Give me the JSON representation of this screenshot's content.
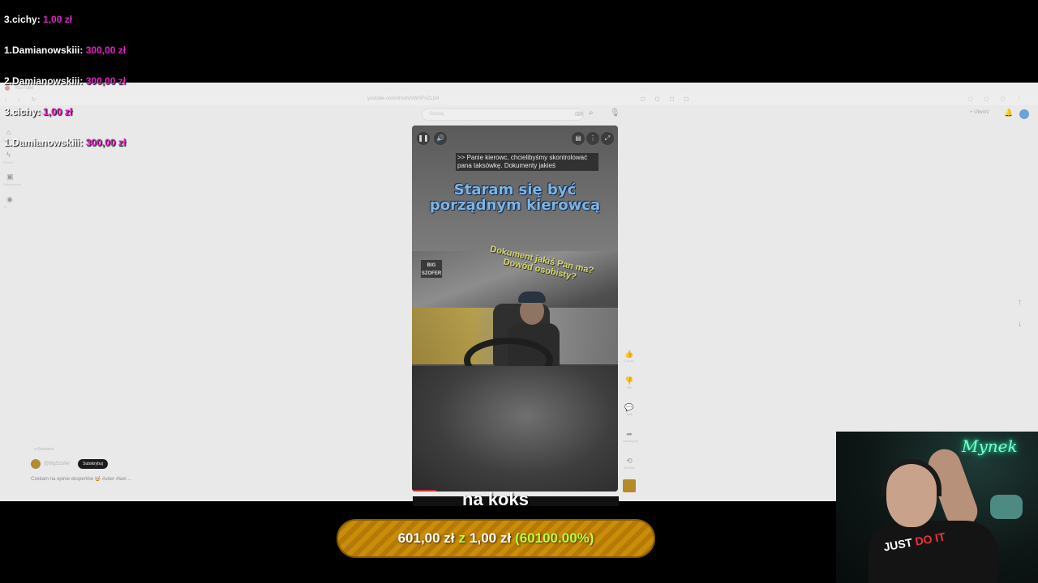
{
  "donations": [
    {
      "name": "3.cichy:",
      "amount": "1,00 zł"
    },
    {
      "name": "1.Damianowskiii:",
      "amount": "300,00 zł"
    },
    {
      "name": "2.Damianowskiii:",
      "amount": "300,00 zł"
    },
    {
      "name": "3.cichy:",
      "amount": "1,00 zł"
    },
    {
      "name": "1.Damianowskiii:",
      "amount": "300,00 zł"
    }
  ],
  "browser": {
    "url": "youtube.com/shorts/xWSFnZLD4",
    "logo": "YouTube",
    "search_placeholder": "Szukaj",
    "create_label": "+ Utwórz"
  },
  "sidebar": [
    {
      "icon": "home-icon",
      "glyph": "⌂",
      "label": "Główna"
    },
    {
      "icon": "shorts-icon",
      "glyph": "ϟ",
      "label": "Shorts"
    },
    {
      "icon": "subscriptions-icon",
      "glyph": "▣",
      "label": "Subskrypcje"
    },
    {
      "icon": "you-icon",
      "glyph": "◉",
      "label": "Ty"
    }
  ],
  "video": {
    "caption": ">> Panie kierowc, chcielibyśmy skontrolować pana taksówkę. Dokumenty jakieś",
    "big_subtitle": "Staram się być porządnym kierowcą",
    "watermark": "BIG SZOFER",
    "yellow_subtitle": "Dokument jakiś Pan ma? Dowód osobisty?"
  },
  "actions": [
    {
      "name": "like-button",
      "glyph": "👍",
      "label": "7,8 tys."
    },
    {
      "name": "dislike-button",
      "glyph": "👎",
      "label": "Nie"
    },
    {
      "name": "comments-button",
      "glyph": "💬",
      "label": "843"
    },
    {
      "name": "share-button",
      "glyph": "➦",
      "label": "Udostępnij"
    },
    {
      "name": "remix-button",
      "glyph": "⟲",
      "label": "Remiks"
    }
  ],
  "channel": {
    "location": "Katowice",
    "handle": "@BigSzofer",
    "subscribe_label": "Subskrybuj",
    "description": "Czekam na opinie ekspertów 🤯 #uber #taxi ..."
  },
  "subtitle_bottom": "na koks",
  "goal": {
    "current": "601,00 zł",
    "separator": "z",
    "target": "1,00 zł",
    "percent": "(60100.00%)"
  },
  "webcam": {
    "neon_sign": "Mynek",
    "shirt_text_a": "JUST",
    "shirt_text_b": "DO IT"
  }
}
